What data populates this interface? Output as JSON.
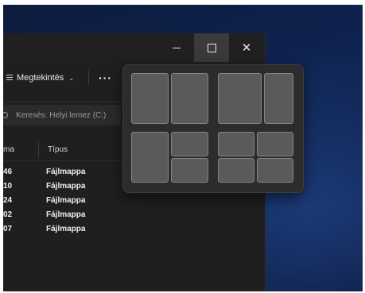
{
  "window": {
    "controls": {
      "close_glyph": "✕"
    }
  },
  "toolbar": {
    "view_label": "Megtekintés",
    "view_chevron": "⌄",
    "more_label": "···"
  },
  "search": {
    "placeholder": "Keresés: Helyi lemez (C:)"
  },
  "columns": {
    "name_partial": "ma",
    "type": "Típus"
  },
  "rows": [
    {
      "time_partial": "46",
      "type": "Fájlmappa"
    },
    {
      "time_partial": "10",
      "type": "Fájlmappa"
    },
    {
      "time_partial": "24",
      "type": "Fájlmappa"
    },
    {
      "time_partial": "02",
      "type": "Fájlmappa"
    },
    {
      "time_partial": "07",
      "type": "Fájlmappa"
    }
  ],
  "snap_layouts": [
    {
      "name": "half-half",
      "zones": 2
    },
    {
      "name": "two-thirds-one-third",
      "zones": 2
    },
    {
      "name": "half-quarter-quarter",
      "zones": 3
    },
    {
      "name": "quadrants",
      "zones": 4
    }
  ],
  "colors": {
    "explorer_bg": "#1f1f1f",
    "snap_bg": "#2c2c2c",
    "zone_fill": "#5a5a5a",
    "desktop_blue": "#0f2452"
  }
}
